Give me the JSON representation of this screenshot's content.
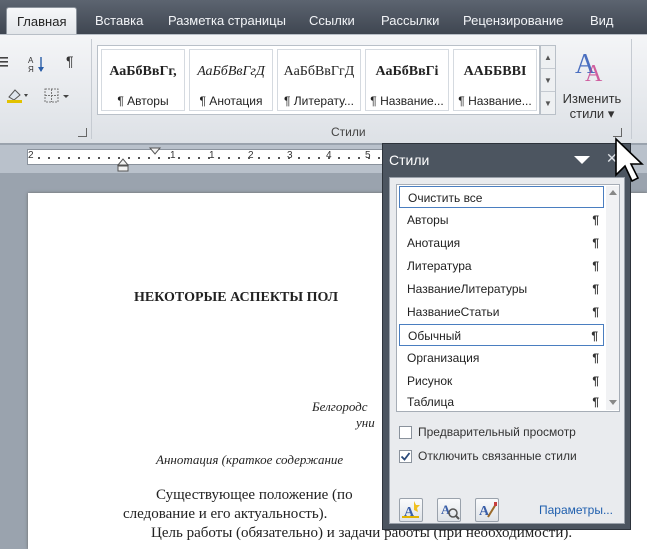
{
  "tabs": [
    "Главная",
    "Вставка",
    "Разметка страницы",
    "Ссылки",
    "Рассылки",
    "Рецензирование",
    "Вид"
  ],
  "ribbon": {
    "paragraph_mark": "¶",
    "styles_group_label": "Стили",
    "gallery": [
      {
        "sample": "АаБбВвГг,",
        "name": "¶ Авторы",
        "bold": true,
        "italic": false
      },
      {
        "sample": "АаБбВвГгД",
        "name": "¶ Анотация",
        "bold": false,
        "italic": true
      },
      {
        "sample": "АаБбВвГгД",
        "name": "¶ Литерату...",
        "bold": false,
        "italic": false
      },
      {
        "sample": "АаБбВвГі",
        "name": "¶ Название...",
        "bold": true,
        "italic": false
      },
      {
        "sample": "ААББВВI",
        "name": "¶ Название...",
        "bold": true,
        "italic": false
      }
    ],
    "change_styles_line1": "Изменить",
    "change_styles_line2": "стили"
  },
  "ruler": {
    "labels": [
      "2",
      "1",
      "1",
      "2",
      "3",
      "4",
      "5",
      "6",
      "7"
    ]
  },
  "document": {
    "title": "НЕКОТОРЫЕ АСПЕКТЫ ПОЛ",
    "affiliation_line1": "Белгородс",
    "affiliation_line2": "уни",
    "annotation": "Аннотация (краткое содержание",
    "body_line1": "Существующее положение (по",
    "body_line2": "следование и его актуальность).",
    "body_line3": "Цель работы (обязательно) и задачи работы (при необходимости)."
  },
  "styles_pane": {
    "title": "Стили",
    "close": "✕",
    "items": [
      {
        "label": "Очистить все",
        "mark": "",
        "selected": true
      },
      {
        "label": "Авторы",
        "mark": "¶",
        "selected": false
      },
      {
        "label": "Анотация",
        "mark": "¶",
        "selected": false
      },
      {
        "label": "Литература",
        "mark": "¶",
        "selected": false
      },
      {
        "label": "НазваниеЛитературы",
        "mark": "¶",
        "selected": false
      },
      {
        "label": "НазваниеСтатьи",
        "mark": "¶",
        "selected": false
      },
      {
        "label": "Обычный",
        "mark": "¶",
        "selected": true
      },
      {
        "label": "Организация",
        "mark": "¶",
        "selected": false
      },
      {
        "label": "Рисунок",
        "mark": "¶",
        "selected": false
      },
      {
        "label": "Таблица",
        "mark": "¶",
        "selected": false
      }
    ],
    "preview_label": "Предварительный просмотр",
    "preview_checked": false,
    "disable_linked_label": "Отключить связанные стили",
    "disable_linked_checked": true,
    "params_link": "Параметры..."
  },
  "colors": {
    "accent": "#4a7ec0",
    "link": "#1f5fae"
  }
}
